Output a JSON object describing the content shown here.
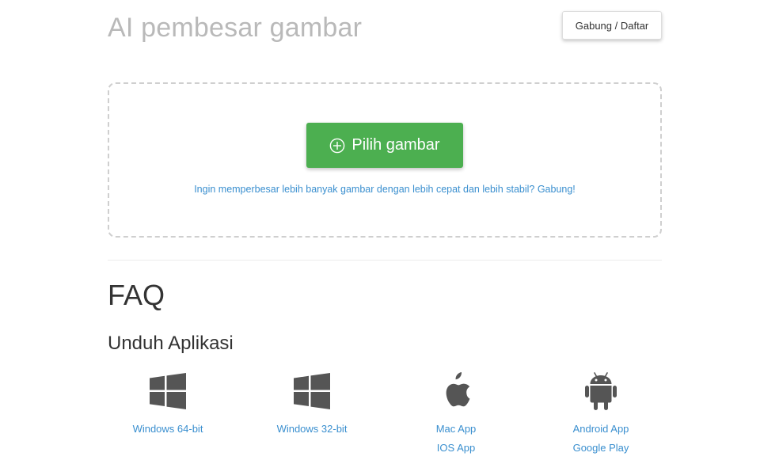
{
  "header": {
    "title": "AI pembesar gambar",
    "login_label": "Gabung / Daftar"
  },
  "upload": {
    "choose_label": "Pilih gambar",
    "upgrade_text": "Ingin memperbesar lebih banyak gambar dengan lebih cepat dan lebih stabil? Gabung!"
  },
  "faq": {
    "heading": "FAQ"
  },
  "apps": {
    "heading": "Unduh Aplikasi",
    "items": [
      {
        "icon": "windows-icon",
        "links": [
          "Windows 64-bit"
        ]
      },
      {
        "icon": "windows-icon",
        "links": [
          "Windows 32-bit"
        ]
      },
      {
        "icon": "apple-icon",
        "links": [
          "Mac App",
          "IOS App"
        ]
      },
      {
        "icon": "android-icon",
        "links": [
          "Android App",
          "Google Play"
        ]
      }
    ]
  },
  "colors": {
    "accent_green": "#4caf50",
    "link_blue": "#3a8fcf",
    "title_gray": "#b9b9b9",
    "icon_gray": "#555555"
  }
}
